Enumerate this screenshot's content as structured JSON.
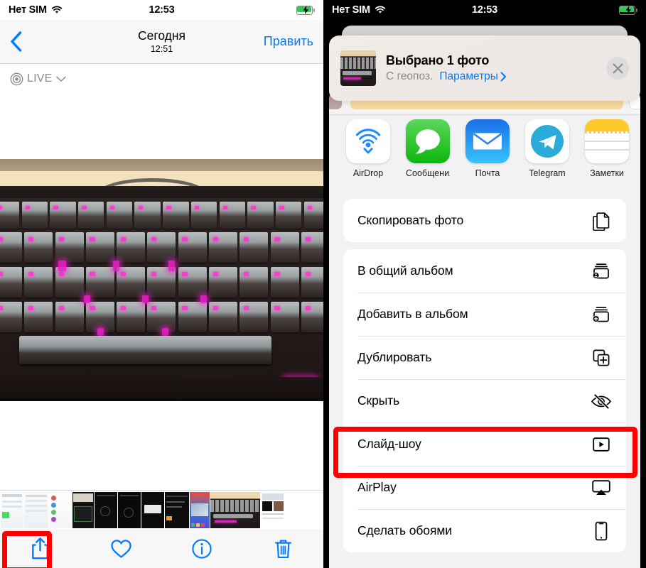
{
  "left": {
    "statusbar": {
      "carrier": "Нет SIM",
      "time": "12:53",
      "wifi_icon": "wifi-icon",
      "battery_icon": "battery-charging-icon"
    },
    "navbar": {
      "back_icon": "chevron-left-icon",
      "title": "Сегодня",
      "subtitle": "12:51",
      "edit_label": "Править"
    },
    "live_badge": {
      "label": "LIVE",
      "icon": "live-photo-icon",
      "chevron": "chevron-down-icon"
    },
    "photo": {
      "alt": "Фото механической клавиатуры с розовой подсветкой"
    },
    "toolbar": {
      "items": [
        {
          "name": "share-button",
          "icon": "share-icon"
        },
        {
          "name": "favorite-button",
          "icon": "heart-icon"
        },
        {
          "name": "info-button",
          "icon": "info-circle-icon"
        },
        {
          "name": "delete-button",
          "icon": "trash-icon"
        }
      ]
    },
    "highlight": {
      "target": "share-button",
      "color": "#ff0000"
    }
  },
  "right": {
    "statusbar": {
      "carrier": "Нет SIM",
      "time": "12:53",
      "wifi_icon": "wifi-icon",
      "battery_icon": "battery-charging-icon"
    },
    "share_header": {
      "title": "Выбрано 1 фото",
      "geo_label": "С геопоз.",
      "options_label": "Параметры",
      "options_chevron": "chevron-right-icon",
      "close_icon": "close-icon"
    },
    "apps": [
      {
        "label": "AirDrop",
        "icon": "airdrop-icon"
      },
      {
        "label": "Сообщения",
        "icon": "messages-icon"
      },
      {
        "label": "Почта",
        "icon": "mail-icon"
      },
      {
        "label": "Telegram",
        "icon": "telegram-icon"
      },
      {
        "label": "Заметки",
        "icon": "notes-icon"
      }
    ],
    "groups": [
      {
        "rows": [
          {
            "label": "Скопировать фото",
            "icon": "copy-icon"
          }
        ]
      },
      {
        "rows": [
          {
            "label": "В общий альбом",
            "icon": "shared-album-icon"
          },
          {
            "label": "Добавить в альбом",
            "icon": "add-to-album-icon"
          },
          {
            "label": "Дублировать",
            "icon": "duplicate-icon"
          },
          {
            "label": "Скрыть",
            "icon": "eye-slash-icon"
          },
          {
            "label": "Слайд-шоу",
            "icon": "play-box-icon"
          },
          {
            "label": "AirPlay",
            "icon": "airplay-icon"
          },
          {
            "label": "Сделать обоями",
            "icon": "phone-icon"
          }
        ]
      }
    ],
    "highlight": {
      "target": "Скрыть",
      "color": "#ff0000"
    }
  },
  "colors": {
    "ios_blue": "#007aff",
    "highlight_red": "#ff0000",
    "battery_green": "#35c759",
    "sheet_bg": "#f2f2f4"
  }
}
